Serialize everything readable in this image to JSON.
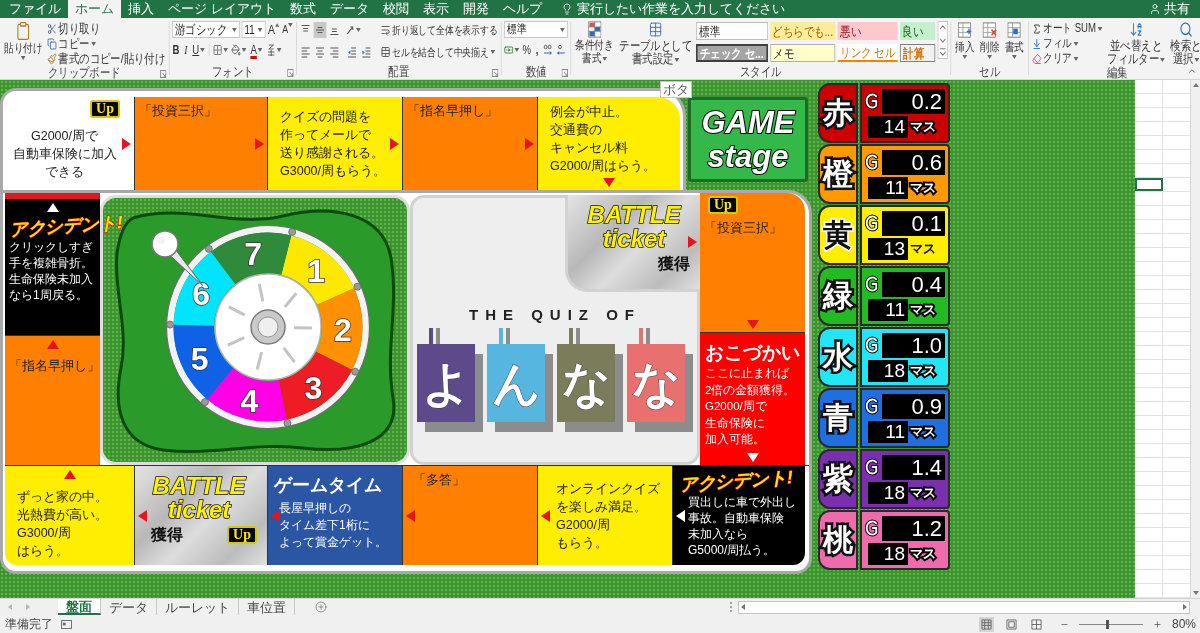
{
  "menu_bar": {
    "tabs": [
      {
        "label": "ファイル",
        "selected": false
      },
      {
        "label": "ホーム",
        "selected": true
      },
      {
        "label": "挿入",
        "selected": false
      },
      {
        "label": "ページ レイアウト",
        "selected": false
      },
      {
        "label": "数式",
        "selected": false
      },
      {
        "label": "データ",
        "selected": false
      },
      {
        "label": "校閲",
        "selected": false
      },
      {
        "label": "表示",
        "selected": false
      },
      {
        "label": "開発",
        "selected": false
      },
      {
        "label": "ヘルプ",
        "selected": false
      }
    ],
    "search": {
      "placeholder": "実行したい作業を入力してください"
    },
    "share": "共有"
  },
  "ribbon": {
    "clipboard": {
      "label": "クリップボード",
      "paste": "貼り付け",
      "cut": "切り取り",
      "copy": "コピー",
      "format_painter": "書式のコピー/貼り付け"
    },
    "font": {
      "label": "フォント",
      "font_name": "游ゴシック",
      "font_size": "11",
      "grow": "A",
      "shrink": "A",
      "bold": "B",
      "italic": "I",
      "underline": "U",
      "font_color": "A"
    },
    "alignment": {
      "label": "配置",
      "vertical": [
        {
          "kind": "top",
          "selected": false
        },
        {
          "kind": "middle",
          "selected": true
        },
        {
          "kind": "bottom",
          "selected": false
        }
      ],
      "wrap_text": "折り返して全体を表示する",
      "merge_center": "セルを結合して中央揃え"
    },
    "number": {
      "label": "数値",
      "format": "標準",
      "percent": "%",
      "comma": ","
    },
    "styles": {
      "label": "スタイル",
      "conditional_formatting": [
        "条件付き",
        "書式"
      ],
      "format_as_table": [
        "テーブルとして",
        "書式設定"
      ],
      "gallery": [
        {
          "label": "標準",
          "kind": "normal"
        },
        {
          "label": "どちらでも...",
          "kind": "neutral"
        },
        {
          "label": "悪い",
          "kind": "bad"
        },
        {
          "label": "良い",
          "kind": "good"
        },
        {
          "label": "チェック セ...",
          "kind": "check"
        },
        {
          "label": "メモ",
          "kind": "note"
        },
        {
          "label": "リンク セル",
          "kind": "linked"
        },
        {
          "label": "計算",
          "kind": "calculation"
        }
      ]
    },
    "cells": {
      "label": "セル",
      "buttons": [
        {
          "label": "挿入",
          "kind": "insert"
        },
        {
          "label": "削除",
          "kind": "delete"
        },
        {
          "label": "書式",
          "kind": "format"
        }
      ]
    },
    "editing": {
      "label": "編集",
      "autosum": "オート SUM",
      "fill": "フィル",
      "clear": "クリア",
      "sort_filter": [
        "並べ替えと",
        "フィルター"
      ],
      "find_select": [
        "検索と",
        "選択"
      ]
    }
  },
  "board": {
    "tag": "ボタ",
    "game_logo": [
      "GAME",
      "stage"
    ],
    "top_row": [
      {
        "kind": "plain",
        "color": "#ffffff",
        "badge": "Up",
        "lines": [
          "G2000/周で",
          "自動車保険に加入",
          "できる"
        ],
        "arrow": {
          "kind": "right"
        }
      },
      {
        "kind": "plain",
        "color": "#ff8000",
        "title": "「投資三択」",
        "arrow": {
          "kind": "right"
        }
      },
      {
        "kind": "plain",
        "color": "#ffee00",
        "lines": [
          "クイズの問題を",
          "作ってメールで",
          "送り感謝される。",
          "G3000/周もらう。"
        ],
        "arrow": {
          "kind": "right"
        }
      },
      {
        "kind": "plain",
        "color": "#ff8000",
        "title": "「指名早押し」",
        "arrow": {
          "kind": "right"
        }
      },
      {
        "kind": "plain",
        "color": "#ffee00",
        "lines": [
          "例会が中止。",
          "交通費の",
          "キャンセル料",
          "G2000/周はらう。"
        ],
        "arrow": {
          "kind": "down"
        }
      }
    ],
    "left_column": [
      {
        "kind": "accident",
        "color": "#000000",
        "heading": "アクシデント!",
        "lines": [
          "クリックしすぎ",
          "手を複雑骨折。",
          "生命保険未加入",
          "なら1周戻る。"
        ],
        "arrow": {
          "kind": "up"
        }
      },
      {
        "kind": "plain",
        "color": "#ff8000",
        "title": "「指名早押し」",
        "arrow": {
          "kind": "up"
        }
      }
    ],
    "battle_notch": {
      "kind": "battle",
      "title": [
        "BATTLE",
        "ticket"
      ],
      "gain": "獲得",
      "arrow": {
        "kind": "right"
      }
    },
    "right_column": [
      {
        "kind": "plain",
        "color": "#ff8000",
        "badge": "Up",
        "title": "「投資三択」",
        "arrow": {
          "kind": "down"
        }
      },
      {
        "kind": "allowance",
        "color": "#ff0000",
        "heading": "おこづかい",
        "lines": [
          "ここに止まれば",
          "2倍の金額獲得。",
          "G2000/周で",
          "生命保険に",
          "加入可能。"
        ],
        "arrow": {
          "kind": "down"
        }
      }
    ],
    "bottom_row": [
      {
        "kind": "plain",
        "color": "#ffee00",
        "lines": [
          "ずっと家の中。",
          "光熱費が高い。",
          "G3000/周",
          "はらう。"
        ],
        "arrow": {
          "kind": "up"
        }
      },
      {
        "kind": "battle",
        "title": [
          "BATTLE",
          "ticket"
        ],
        "gain": "獲得",
        "badge": "Up",
        "arrow": {
          "kind": "left"
        }
      },
      {
        "kind": "gametime",
        "color": "#2b56a3",
        "heading": "ゲームタイム",
        "lines": [
          "長屋早押しの",
          "タイム差下1桁に",
          "よって賞金ゲット。"
        ],
        "arrow": {
          "kind": "left"
        }
      },
      {
        "kind": "plain",
        "color": "#ff8000",
        "title": "「多答」",
        "arrow": {
          "kind": "left"
        }
      },
      {
        "kind": "plain",
        "color": "#ffee00",
        "lines": [
          "オンラインクイズ",
          "を楽しみ満足。",
          "G2000/周",
          "もらう。"
        ],
        "arrow": {
          "kind": "left"
        }
      },
      {
        "kind": "accident",
        "color": "#000000",
        "heading": "アクシデント!",
        "lines": [
          "買出しに車で外出し",
          "事故。自動車保険",
          "未加入なら",
          "G5000/周払う。"
        ],
        "arrow": {
          "kind": "left"
        }
      }
    ],
    "roulette": {
      "segments": [
        {
          "label": "1",
          "color": "#ffe800"
        },
        {
          "label": "2",
          "color": "#ff9000"
        },
        {
          "label": "3",
          "color": "#ee1c25"
        },
        {
          "label": "4",
          "color": "#ff00e6"
        },
        {
          "label": "5",
          "color": "#0f62e8"
        },
        {
          "label": "6",
          "color": "#00e4ff"
        },
        {
          "label": "7",
          "color": "#2f8a3c"
        }
      ]
    },
    "quiz_logo": {
      "caption": "THE QUIZ OF",
      "tiles": [
        {
          "char": "よ",
          "color": "#5d4a8a"
        },
        {
          "char": "ん",
          "color": "#56b6e0"
        },
        {
          "char": "な",
          "color": "#7a7c5a"
        },
        {
          "char": "な",
          "color": "#e8716f"
        }
      ]
    }
  },
  "players": [
    {
      "name": "赤",
      "color": "#cc0000",
      "value": "0.2",
      "squares": "14",
      "unit": "マス"
    },
    {
      "name": "橙",
      "color": "#ff9900",
      "value": "0.6",
      "squares": "11",
      "unit": "マス"
    },
    {
      "name": "黄",
      "color": "#ffee00",
      "value": "0.1",
      "squares": "13",
      "unit": "マス"
    },
    {
      "name": "緑",
      "color": "#22bb22",
      "value": "0.4",
      "squares": "11",
      "unit": "マス"
    },
    {
      "name": "水",
      "color": "#22e5f5",
      "value": "1.0",
      "squares": "18",
      "unit": "マス"
    },
    {
      "name": "青",
      "color": "#1f6fe0",
      "value": "0.9",
      "squares": "11",
      "unit": "マス"
    },
    {
      "name": "紫",
      "color": "#7b2fae",
      "value": "1.4",
      "squares": "18",
      "unit": "マス"
    },
    {
      "name": "桃",
      "color": "#f06aae",
      "value": "1.2",
      "squares": "18",
      "unit": "マス"
    }
  ],
  "sheet_grid": {
    "rows": [
      {
        "selected": false
      },
      {
        "selected": false
      },
      {
        "selected": false
      },
      {
        "selected": false
      },
      {
        "selected": false
      },
      {
        "selected": false
      },
      {
        "selected": false
      },
      {
        "selected": true
      },
      {
        "selected": false
      },
      {
        "selected": false
      },
      {
        "selected": false
      },
      {
        "selected": false
      },
      {
        "selected": false
      },
      {
        "selected": false
      },
      {
        "selected": false
      },
      {
        "selected": false
      },
      {
        "selected": false
      },
      {
        "selected": false
      },
      {
        "selected": false
      },
      {
        "selected": false
      },
      {
        "selected": false
      },
      {
        "selected": false
      },
      {
        "selected": false
      },
      {
        "selected": false
      },
      {
        "selected": false
      },
      {
        "selected": false
      },
      {
        "selected": false
      },
      {
        "selected": false
      },
      {
        "selected": false
      },
      {
        "selected": false
      },
      {
        "selected": false
      },
      {
        "selected": false
      },
      {
        "selected": false
      },
      {
        "selected": false
      },
      {
        "selected": false
      },
      {
        "selected": false
      },
      {
        "selected": false
      }
    ]
  },
  "sheet_tabs": [
    {
      "label": "盤面",
      "selected": true
    },
    {
      "label": "データ",
      "selected": false
    },
    {
      "label": "ルーレット",
      "selected": false
    },
    {
      "label": "車位置",
      "selected": false
    }
  ],
  "status_bar": {
    "status": "準備完了",
    "views": [
      {
        "kind": "normal",
        "selected": true
      },
      {
        "kind": "page_layout",
        "selected": false
      },
      {
        "kind": "page_break",
        "selected": false
      }
    ],
    "zoom": {
      "level": 0.45,
      "reading": "80%"
    }
  }
}
